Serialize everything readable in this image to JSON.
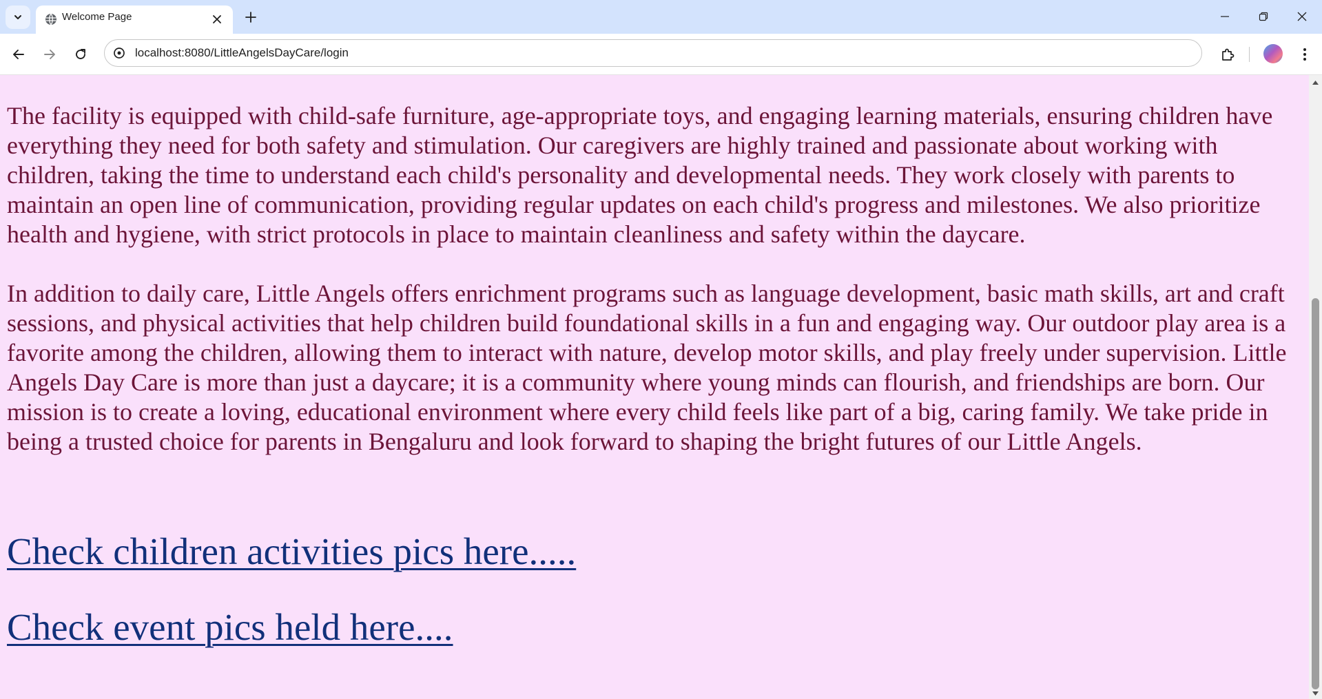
{
  "browser": {
    "tab_title": "Welcome Page",
    "url": "localhost:8080/LittleAngelsDayCare/login",
    "icons": {
      "tab_search": "chevron-down-icon",
      "favicon": "globe-icon",
      "tab_close": "close-icon",
      "new_tab": "plus-icon",
      "minimize": "minimize-icon",
      "restore": "restore-icon",
      "close_window": "close-icon",
      "back": "arrow-left-icon",
      "forward": "arrow-right-icon",
      "reload": "reload-icon",
      "site_info": "site-info-icon",
      "extensions": "puzzle-icon",
      "menu": "kebab-menu-icon"
    },
    "colors": {
      "tabstrip": "#d3e3fd",
      "page_background": "#fae0fb",
      "body_text": "#6b1438",
      "link_text": "#11307a"
    }
  },
  "page": {
    "paragraphs": [
      "The facility is equipped with child-safe furniture, age-appropriate toys, and engaging learning materials, ensuring children have everything they need for both safety and stimulation. Our caregivers are highly trained and passionate about working with children, taking the time to understand each child's personality and developmental needs. They work closely with parents to maintain an open line of communication, providing regular updates on each child's progress and milestones. We also prioritize health and hygiene, with strict protocols in place to maintain cleanliness and safety within the daycare.",
      "In addition to daily care, Little Angels offers enrichment programs such as language development, basic math skills, art and craft sessions, and physical activities that help children build foundational skills in a fun and engaging way. Our outdoor play area is a favorite among the children, allowing them to interact with nature, develop motor skills, and play freely under supervision. Little Angels Day Care is more than just a daycare; it is a community where young minds can flourish, and friendships are born. Our mission is to create a loving, educational environment where every child feels like part of a big, caring family. We take pride in being a trusted choice for parents in Bengaluru and look forward to shaping the bright futures of our Little Angels."
    ],
    "links": {
      "activities": "Check children activities pics here.....",
      "events": "Check event pics held here...."
    }
  }
}
